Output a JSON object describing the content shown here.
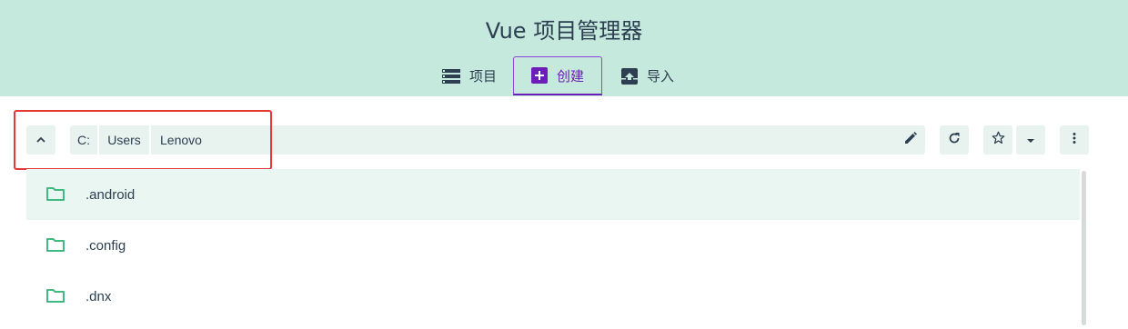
{
  "header": {
    "title": "Vue 项目管理器",
    "tabs": [
      {
        "label": "项目",
        "icon": "list-icon",
        "active": false
      },
      {
        "label": "创建",
        "icon": "add-box-icon",
        "active": true
      },
      {
        "label": "导入",
        "icon": "unarchive-icon",
        "active": false
      }
    ]
  },
  "toolbar": {
    "path": [
      "C:",
      "Users",
      "Lenovo"
    ],
    "buttons": [
      "up-icon",
      "edit-icon",
      "refresh-icon",
      "star-icon",
      "dropdown-icon",
      "more-icon"
    ]
  },
  "folders": [
    {
      "name": ".android",
      "selected": true
    },
    {
      "name": ".config",
      "selected": false
    },
    {
      "name": ".dnx",
      "selected": false
    }
  ],
  "colors": {
    "header_bg": "#c6e9de",
    "accent": "#6b1fb8",
    "folder_icon": "#42b983",
    "highlight": "#e53935"
  }
}
